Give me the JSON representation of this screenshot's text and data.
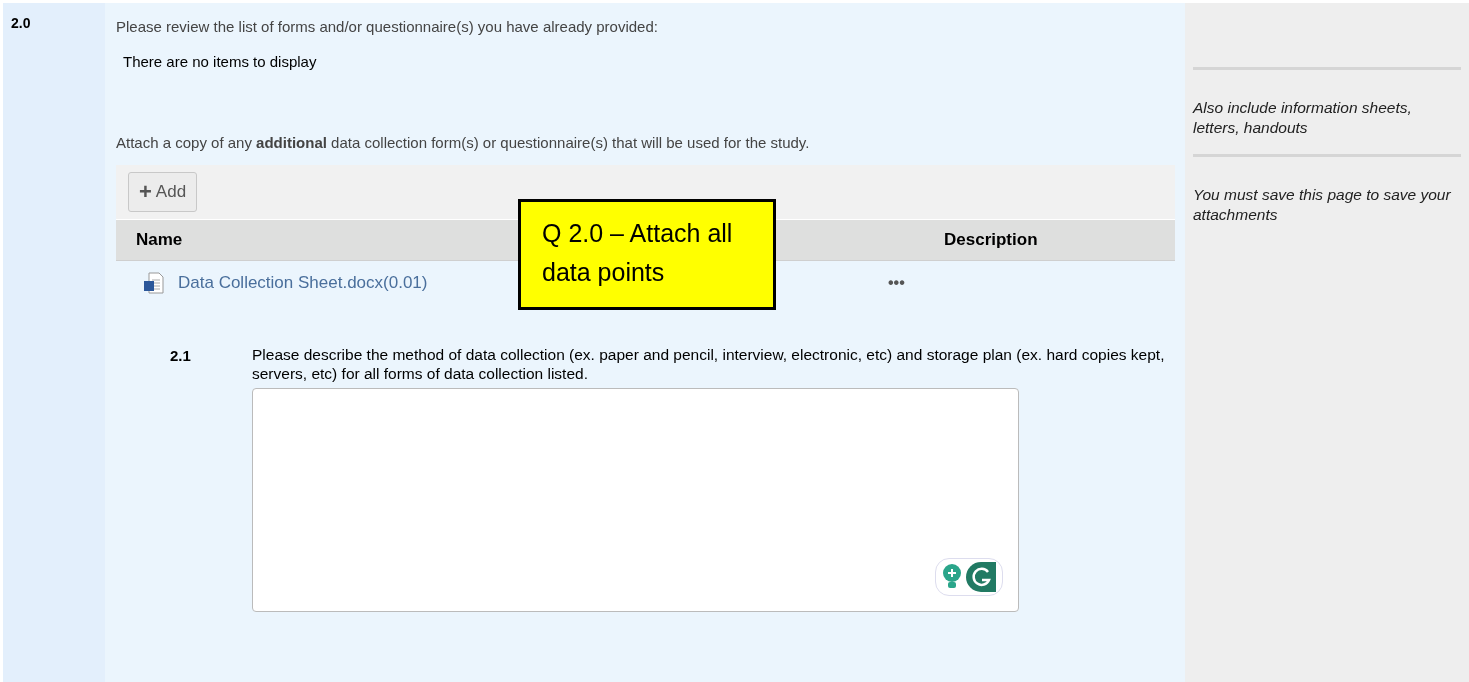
{
  "question": {
    "number": "2.0",
    "review_prompt": "Please review the list of forms and/or questionnaire(s) you have already provided:",
    "empty_message": "There are no items to display",
    "attach_prompt": "Attach a copy of any **additional** data collection form(s) or questionnaire(s) that will be used for the study.",
    "add_button": {
      "icon": "+",
      "label": "Add"
    },
    "table": {
      "columns": [
        "Name",
        "Description"
      ],
      "rows": [
        {
          "name": "Data Collection Sheet.docx(0.01)",
          "description": "•••"
        }
      ]
    }
  },
  "callout": {
    "text": "Q 2.0 – Attach all data points"
  },
  "sub_question": {
    "number": "2.1",
    "text": "Please describe the method of data collection (ex. paper and pencil, interview, electronic, etc) and storage plan (ex. hard copies kept, servers, etc) for all forms of data collection listed."
  },
  "sidebar": {
    "notes": [
      "Also include information sheets, letters, handouts",
      "You must save this page to save your attachments"
    ]
  }
}
